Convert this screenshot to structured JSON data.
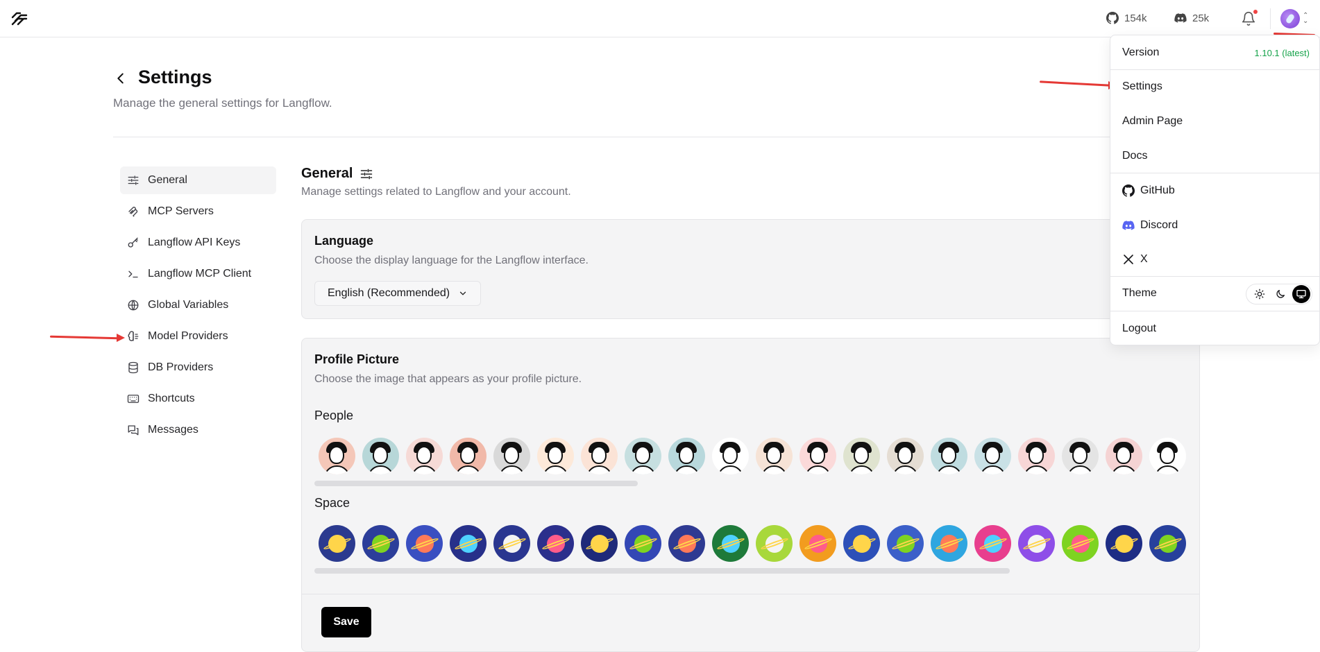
{
  "topbar": {
    "github_count": "154k",
    "discord_count": "25k",
    "icons": [
      "langflow-logo-icon",
      "github-icon",
      "discord-icon",
      "bell-icon",
      "avatar"
    ]
  },
  "page": {
    "title": "Settings",
    "subtitle": "Manage the general settings for Langflow."
  },
  "sidebar": {
    "items": [
      {
        "label": "General",
        "icon": "sliders-icon",
        "active": true
      },
      {
        "label": "MCP Servers",
        "icon": "mcp-icon"
      },
      {
        "label": "Langflow API Keys",
        "icon": "key-icon"
      },
      {
        "label": "Langflow MCP Client",
        "icon": "terminal-icon"
      },
      {
        "label": "Global Variables",
        "icon": "globe-icon"
      },
      {
        "label": "Model Providers",
        "icon": "brain-icon"
      },
      {
        "label": "DB Providers",
        "icon": "database-icon"
      },
      {
        "label": "Shortcuts",
        "icon": "keyboard-icon"
      },
      {
        "label": "Messages",
        "icon": "messages-icon"
      }
    ]
  },
  "main": {
    "title": "General",
    "subtitle": "Manage settings related to Langflow and your account."
  },
  "language_card": {
    "title": "Language",
    "description": "Choose the display language for the Langflow interface.",
    "selected": "English (Recommended)"
  },
  "profile_card": {
    "title": "Profile Picture",
    "description": "Choose the image that appears as your profile picture.",
    "people_label": "People",
    "space_label": "Space",
    "save_label": "Save",
    "people_colors": [
      "#f4c7b8",
      "#b7d7d8",
      "#f6dad6",
      "#f1b9a9",
      "#d9d9d9",
      "#fde9d9",
      "#fbe3d6",
      "#c6dfe0",
      "#b8d8dc",
      "#ffffff",
      "#f6e3d6",
      "#fbd9d9",
      "#dfe3cf",
      "#e5ddd3",
      "#bfdce0",
      "#c9e1e6",
      "#f7d6d6",
      "#e4e4e4",
      "#f5d3d3",
      "#ffffff"
    ],
    "space_colors": [
      "#2b3a8f",
      "#2c3e9a",
      "#3a4fc1",
      "#27308a",
      "#2a3690",
      "#2b2f8c",
      "#1f2a7a",
      "#3347b5",
      "#2e3a92",
      "#1e7a3a",
      "#a8d83b",
      "#f29c1f",
      "#2d50b8",
      "#3b5fc9",
      "#2fa6e0",
      "#e83f8e",
      "#8e4ee8",
      "#7ed321",
      "#1e2d85",
      "#27409c"
    ]
  },
  "menu": {
    "version_label": "Version",
    "version_value": "1.10.1 (latest)",
    "items": [
      "Settings",
      "Admin Page",
      "Docs"
    ],
    "links": [
      "GitHub",
      "Discord",
      "X"
    ],
    "theme_label": "Theme",
    "logout_label": "Logout"
  },
  "annotation_color": "#e53935"
}
